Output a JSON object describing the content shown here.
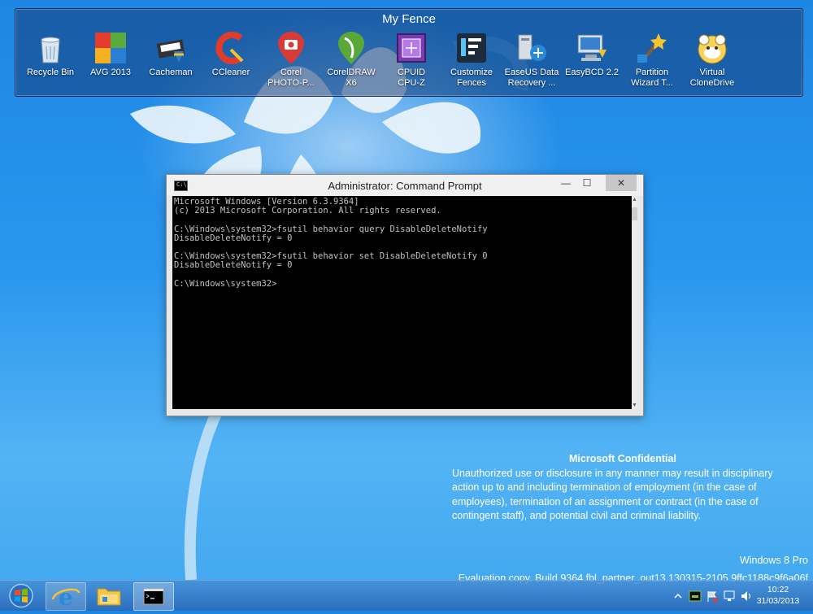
{
  "fence": {
    "title": "My Fence",
    "items": [
      {
        "label": "Recycle Bin",
        "icon": "recycle-bin-icon"
      },
      {
        "label": "AVG 2013",
        "icon": "avg-icon"
      },
      {
        "label": "Cacheman",
        "icon": "cacheman-icon"
      },
      {
        "label": "CCleaner",
        "icon": "ccleaner-icon"
      },
      {
        "label": "Corel\nPHOTO-P...",
        "icon": "corel-photo-paint-icon"
      },
      {
        "label": "CorelDRAW\nX6",
        "icon": "coreldraw-icon"
      },
      {
        "label": "CPUID\nCPU-Z",
        "icon": "cpuz-icon"
      },
      {
        "label": "Customize\nFences",
        "icon": "fences-icon"
      },
      {
        "label": "EaseUS Data\nRecovery ...",
        "icon": "easeus-icon"
      },
      {
        "label": "EasyBCD 2.2",
        "icon": "easybcd-icon"
      },
      {
        "label": "Partition\nWizard T...",
        "icon": "partition-wizard-icon"
      },
      {
        "label": "Virtual\nCloneDrive",
        "icon": "virtual-clonedrive-icon"
      }
    ]
  },
  "cmd": {
    "title": "Administrator: Command Prompt",
    "icon_text": "C:\\_",
    "output": "Microsoft Windows [Version 6.3.9364]\n(c) 2013 Microsoft Corporation. All rights reserved.\n\nC:\\Windows\\system32>fsutil behavior query DisableDeleteNotify\nDisableDeleteNotify = 0\n\nC:\\Windows\\system32>fsutil behavior set DisableDeleteNotify 0\nDisableDeleteNotify = 0\n\nC:\\Windows\\system32>",
    "minimize_glyph": "—",
    "maximize_glyph": "☐",
    "close_glyph": "✕"
  },
  "watermark": {
    "heading": "Microsoft Confidential",
    "text": "Unauthorized use or disclosure in any manner may result in disciplinary action up to and including termination of employment (in the case of employees), termination of an assignment or contract (in the case of contingent staff), and potential civil and criminal liability.",
    "edition": "Windows 8 Pro",
    "build": "Evaluation copy. Build 9364.fbl_partner_out13.130315-2105.9ffc1188c9f6a06f"
  },
  "taskbar": {
    "time": "10:22",
    "date": "31/03/2013"
  }
}
